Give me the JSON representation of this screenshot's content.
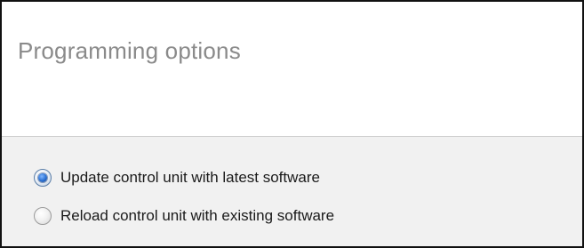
{
  "header": {
    "title": "Programming options"
  },
  "options": [
    {
      "label": "Update control unit with latest software",
      "selected": true
    },
    {
      "label": "Reload control unit with existing software",
      "selected": false
    }
  ],
  "colors": {
    "title_text": "#8a8a8a",
    "options_background": "#f1f1f1",
    "radio_selected": "#2a6fd1"
  }
}
